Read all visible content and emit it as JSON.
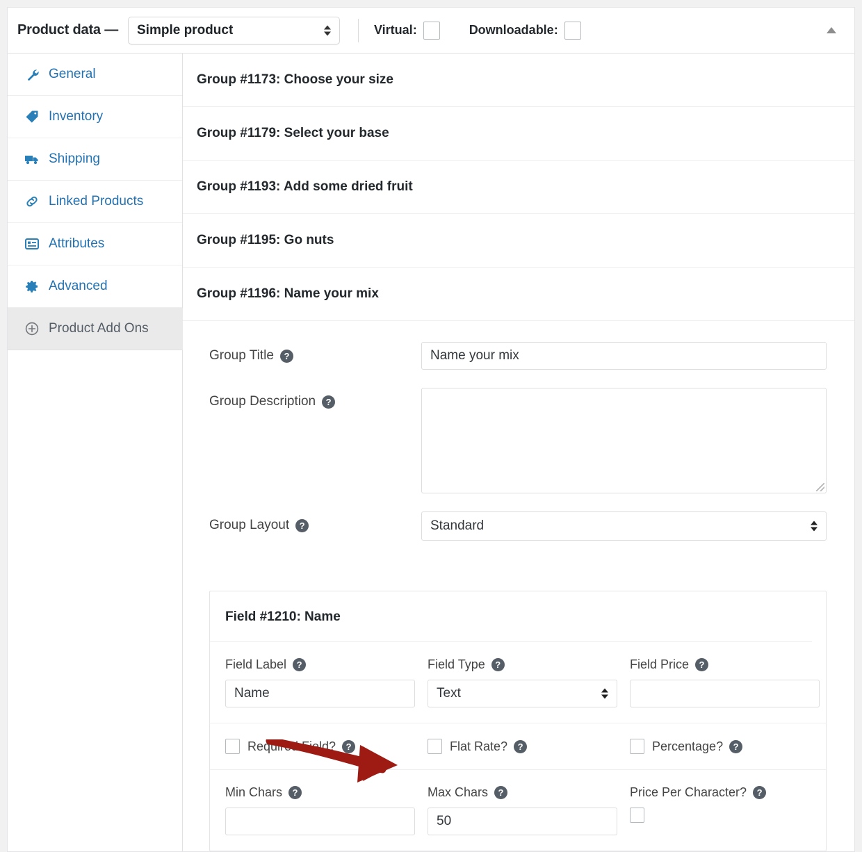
{
  "header": {
    "title": "Product data —",
    "product_type": "Simple product",
    "virtual_label": "Virtual:",
    "virtual_checked": false,
    "downloadable_label": "Downloadable:",
    "downloadable_checked": false,
    "collapse_icon": "caret-up-icon"
  },
  "sidebar": {
    "items": [
      {
        "label": "General",
        "icon": "wrench-icon",
        "active": false
      },
      {
        "label": "Inventory",
        "icon": "tag-icon",
        "active": false
      },
      {
        "label": "Shipping",
        "icon": "truck-icon",
        "active": false
      },
      {
        "label": "Linked Products",
        "icon": "link-icon",
        "active": false
      },
      {
        "label": "Attributes",
        "icon": "list-icon",
        "active": false
      },
      {
        "label": "Advanced",
        "icon": "gear-icon",
        "active": false
      },
      {
        "label": "Product Add Ons",
        "icon": "plus-circle-icon",
        "active": true
      }
    ]
  },
  "groups": [
    {
      "title": "Group #1173: Choose your size"
    },
    {
      "title": "Group #1179: Select your base"
    },
    {
      "title": "Group #1193: Add some dried fruit"
    },
    {
      "title": "Group #1195: Go nuts"
    },
    {
      "title": "Group #1196: Name your mix"
    }
  ],
  "open_group": {
    "title": "Group #1196: Name your mix",
    "group_title": {
      "label": "Group Title",
      "value": "Name your mix",
      "help": "?"
    },
    "group_description": {
      "label": "Group Description",
      "value": "",
      "help": "?"
    },
    "group_layout": {
      "label": "Group Layout",
      "value": "Standard",
      "help": "?"
    }
  },
  "field_card": {
    "title": "Field #1210: Name",
    "row1": [
      {
        "label": "Field Label",
        "help": "?",
        "value": "Name",
        "type": "text"
      },
      {
        "label": "Field Type",
        "help": "?",
        "value": "Text",
        "type": "select"
      },
      {
        "label": "Field Price",
        "help": "?",
        "value": "",
        "type": "text"
      }
    ],
    "row2": [
      {
        "label": "Required Field?",
        "help": "?",
        "checked": false
      },
      {
        "label": "Flat Rate?",
        "help": "?",
        "checked": false
      },
      {
        "label": "Percentage?",
        "help": "?",
        "checked": false
      }
    ],
    "row3": [
      {
        "label": "Min Chars",
        "help": "?",
        "value": "",
        "type": "text"
      },
      {
        "label": "Max Chars",
        "help": "?",
        "value": "50",
        "type": "text"
      },
      {
        "label": "Price Per Character?",
        "help": "?",
        "checked": false,
        "type": "checkbox"
      }
    ]
  },
  "annotation": {
    "kind": "arrow-pointing-right",
    "color": "#9e1b14",
    "points_to": "Max Chars"
  },
  "colors": {
    "link": "#2271b1",
    "icon": "#2980b9",
    "text": "#23282d",
    "muted": "#444444",
    "active_tab_bg": "#eaeaea",
    "border": "#e1e1e1",
    "page_bg": "#f1f1f1",
    "annotation_red": "#9e1b14"
  }
}
